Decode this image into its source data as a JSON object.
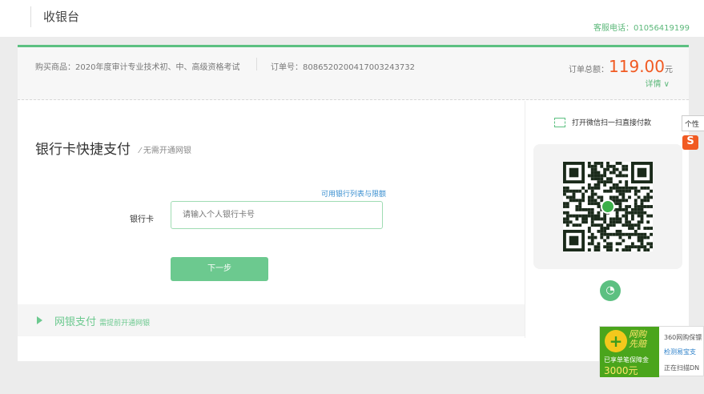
{
  "header": {
    "title": "收银台",
    "phone": "客服电话：01056419199"
  },
  "order": {
    "goods": "购买商品：2020年度审计专业技术初、中、高级资格考试",
    "order_no": "订单号：8086520200417003243732",
    "total_label": "订单总额：",
    "amount": "119.00",
    "unit": "元",
    "details": "详情 ∨"
  },
  "quickpay": {
    "title": "银行卡快捷支付",
    "subtitle": "⁄ 无需开通网银",
    "bank_list_link": "可用银行列表与限额",
    "card_label": "银行卡",
    "card_placeholder": "请输入个人银行卡号",
    "next_button": "下一步"
  },
  "netbank": {
    "title": "网银支付",
    "subtitle": "需提前开通网银"
  },
  "wechat": {
    "scan_text": "打开微信扫一扫直接付款"
  },
  "tooltip": {
    "text": "个性"
  },
  "ad360": {
    "badge_line1": "网购",
    "badge_line2": "先赔",
    "guarantee": "已享单笔保障金",
    "guarantee_amount": "3000元",
    "line1": "360网购保镖",
    "line2": "检测易宝支",
    "line3": "正在扫描DN"
  }
}
